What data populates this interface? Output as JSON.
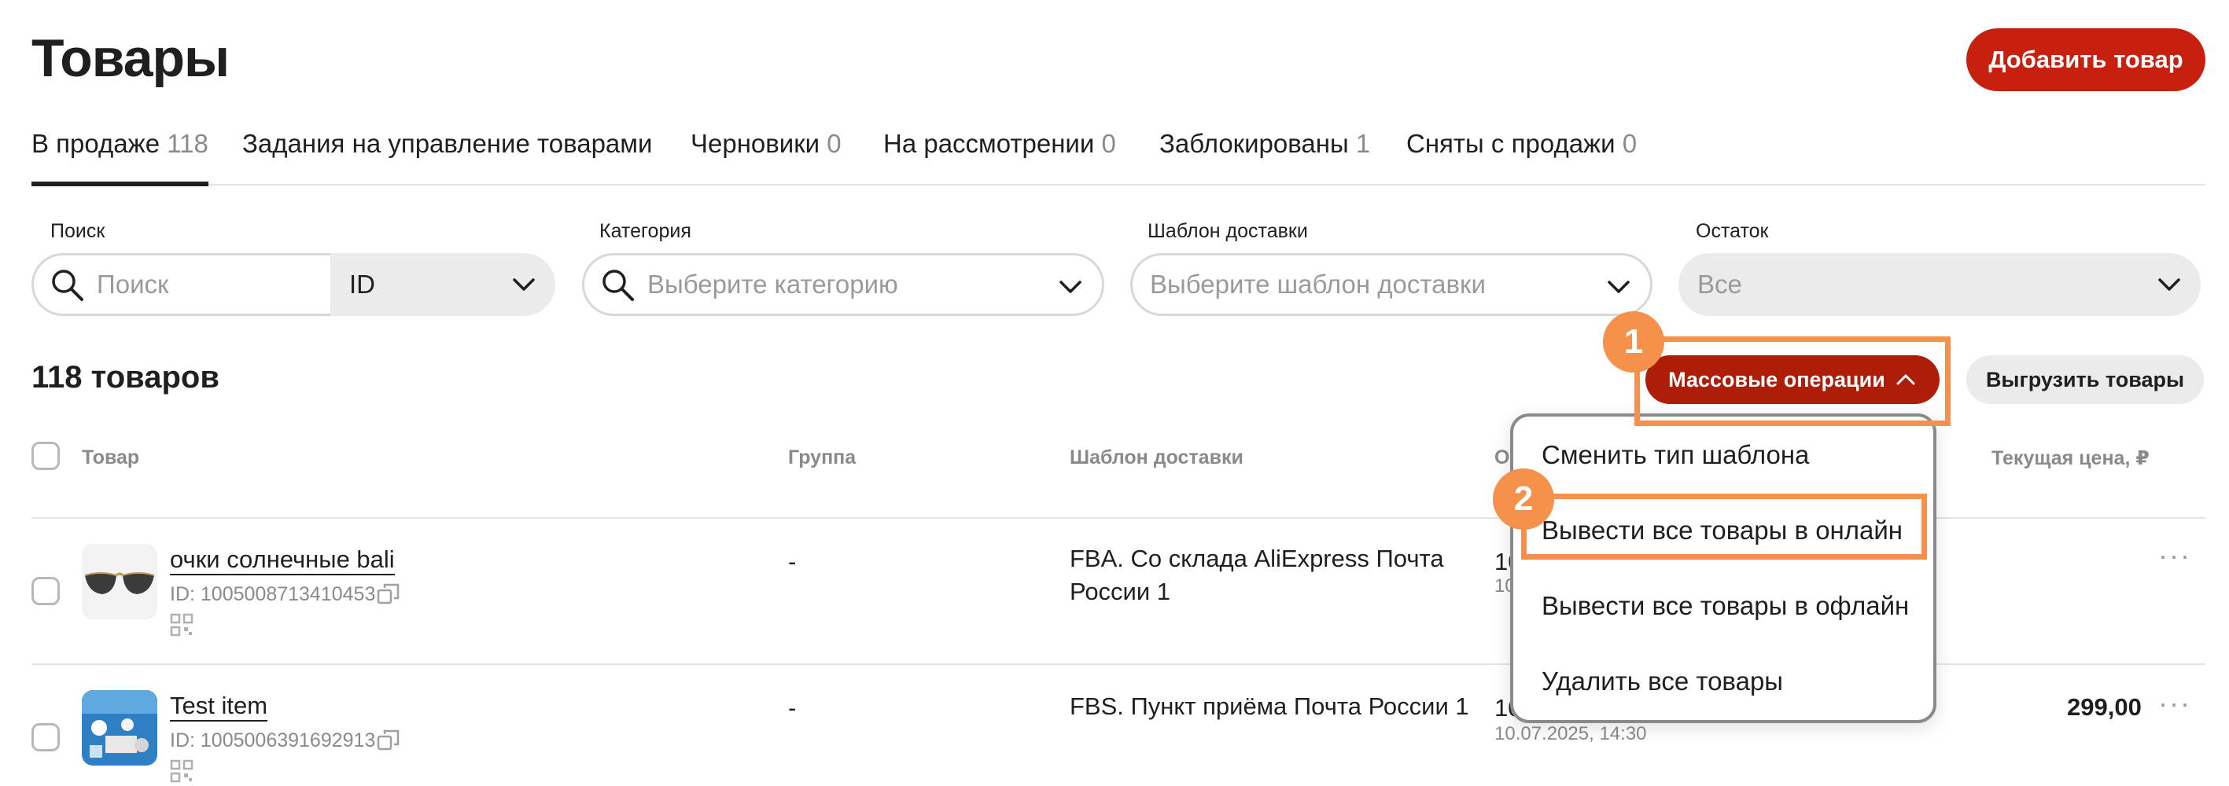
{
  "header": {
    "title": "Товары",
    "add_button": "Добавить товар"
  },
  "tabs": [
    {
      "label": "В продаже",
      "count": "118"
    },
    {
      "label": "Задания на управление товарами",
      "count": ""
    },
    {
      "label": "Черновики",
      "count": "0"
    },
    {
      "label": "На рассмотрении",
      "count": "0"
    },
    {
      "label": "Заблокированы",
      "count": "1"
    },
    {
      "label": "Сняты с продажи",
      "count": "0"
    }
  ],
  "filters": {
    "search": {
      "label": "Поиск",
      "placeholder": "Поиск",
      "type_value": "ID"
    },
    "category": {
      "label": "Категория",
      "placeholder": "Выберите категорию"
    },
    "delivery": {
      "label": "Шаблон доставки",
      "placeholder": "Выберите шаблон доставки"
    },
    "stock": {
      "label": "Остаток",
      "value": "Все"
    }
  },
  "toolbar": {
    "count": "118 товаров",
    "mass_ops": "Массовые операции",
    "export": "Выгрузить товары"
  },
  "columns": {
    "product": "Товар",
    "group": "Группа",
    "delivery": "Шаблон доставки",
    "col4_partial": "О",
    "price": "Текущая цена, ₽"
  },
  "rows": [
    {
      "name": "очки солнечные bali",
      "id": "ID: 1005008713410453",
      "group": "-",
      "delivery": "FBA. Со склада AliExpress Почта России 1",
      "col4_a": "10",
      "col4_b": "10",
      "price": ""
    },
    {
      "name": "Test item",
      "id": "ID: 1005006391692913",
      "group": "-",
      "delivery": "FBS. Пункт приёма Почта России 1",
      "col4_a": "10",
      "col4_b": "10.07.2025, 14:30",
      "price": "299,00"
    }
  ],
  "menu": {
    "items": [
      "Сменить тип шаблона",
      "Вывести все товары в онлайн",
      "Вывести все товары в офлайн",
      "Удалить все товары"
    ]
  },
  "annotations": {
    "step1": "1",
    "step2": "2",
    "color": "#f5914a"
  },
  "colors": {
    "brand_red": "#c8200e",
    "mass_ops_red": "#ad1d07",
    "text": "#1f1f1f",
    "muted": "#8a8a8a"
  }
}
